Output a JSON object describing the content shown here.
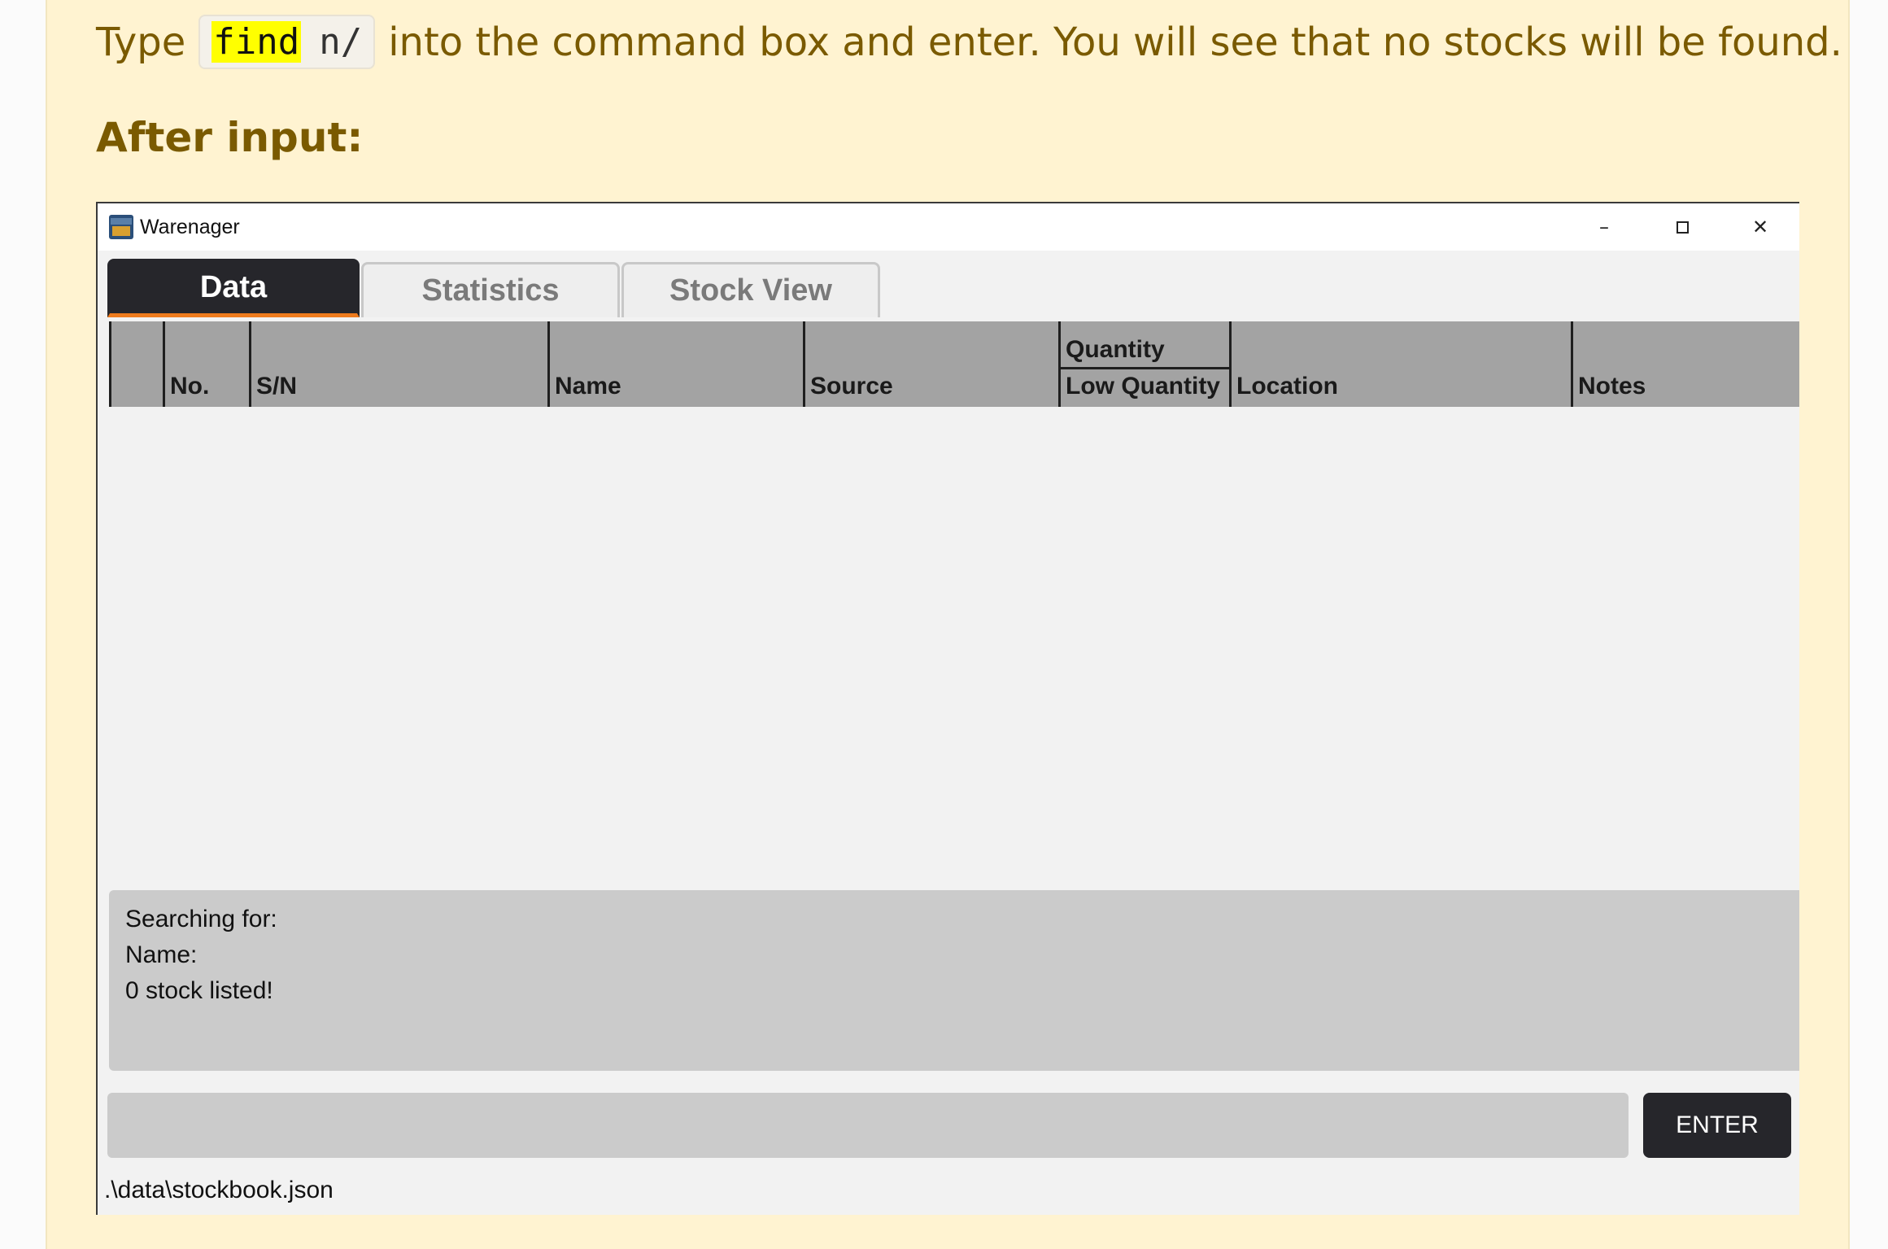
{
  "doc": {
    "instruction_before": "Type",
    "code_keyword": "find",
    "code_rest": "n/",
    "instruction_after": "into the command box and enter. You will see that no stocks will be found.",
    "heading": "After input:"
  },
  "window": {
    "title": "Warenager",
    "icon": "warehouse-app-icon",
    "controls": {
      "minimize": "–",
      "close": "✕"
    }
  },
  "tabs": [
    {
      "label": "Data",
      "active": true
    },
    {
      "label": "Statistics",
      "active": false
    },
    {
      "label": "Stock View",
      "active": false
    }
  ],
  "table": {
    "columns": {
      "no": "No.",
      "sn": "S/N",
      "name": "Name",
      "source": "Source",
      "quantity": "Quantity",
      "low_quantity": "Low Quantity",
      "location": "Location",
      "notes": "Notes"
    },
    "rows": []
  },
  "result": {
    "line1": "Searching for:",
    "line2": "Name:",
    "line3": "0 stock listed!"
  },
  "command": {
    "value": "",
    "enter_label": "ENTER"
  },
  "status": {
    "file_path": ".\\data\\stockbook.json"
  },
  "colors": {
    "doc_background": "#fff3d1",
    "doc_text": "#7a5a00",
    "active_tab": "#26262b",
    "tab_accent": "#ee7b1d",
    "header_bg": "#a3a3a3",
    "panel_bg": "#cbcbcb",
    "highlight": "#ffff00"
  }
}
